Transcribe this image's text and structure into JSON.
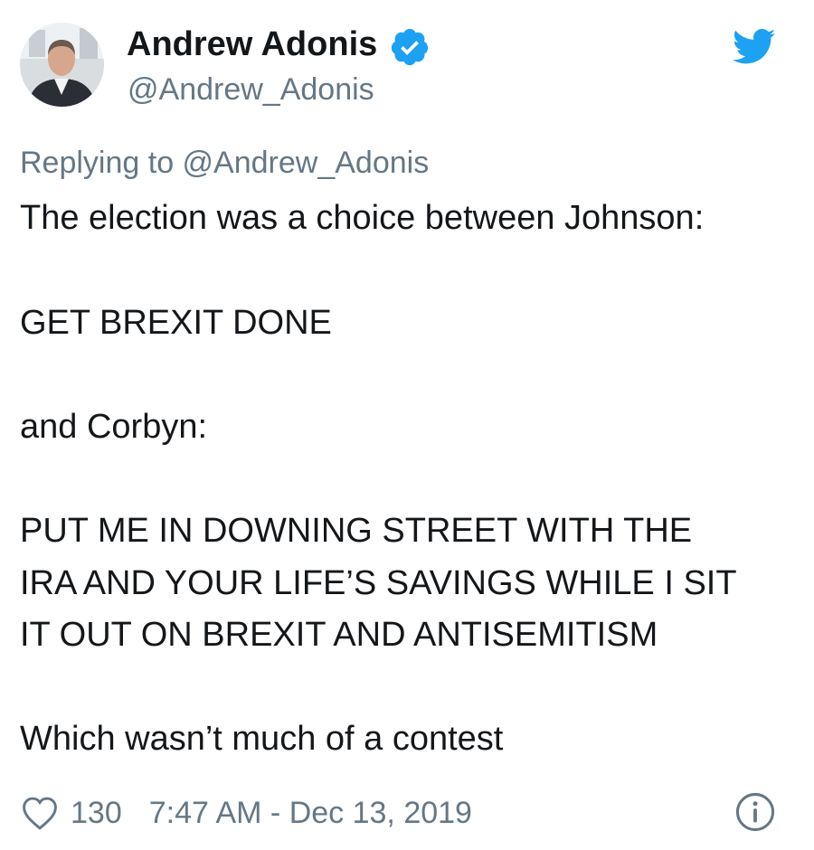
{
  "author": {
    "display_name": "Andrew Adonis",
    "handle": "@Andrew_Adonis",
    "verified": true,
    "avatar_icon": "profile-photo",
    "verified_icon": "verified-badge-icon",
    "brand_icon": "twitter-bird-icon"
  },
  "reply": {
    "text": "Replying to @Andrew_Adonis"
  },
  "tweet": {
    "lines": [
      "The election was a choice between Johnson:",
      "GET BREXIT DONE",
      "and Corbyn:",
      "PUT ME IN DOWNING STREET WITH THE",
      "IRA AND YOUR LIFE’S SAVINGS WHILE I SIT",
      "IT OUT ON BREXIT AND ANTISEMITISM",
      "Which wasn’t much of a contest"
    ]
  },
  "footer": {
    "like_count": "130",
    "timestamp": "7:47 AM - Dec 13, 2019",
    "like_icon": "heart-icon",
    "info_icon": "info-icon"
  },
  "colors": {
    "text": "#14171a",
    "secondary": "#657786",
    "accent": "#1da1f2",
    "background": "#ffffff"
  }
}
